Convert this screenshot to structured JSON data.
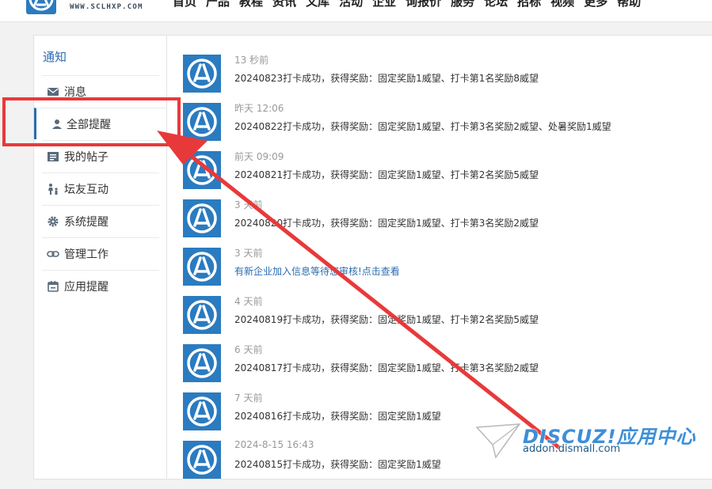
{
  "header": {
    "site_url": "WWW.SCLHXP.COM",
    "nav": [
      "首页",
      "产品",
      "教程",
      "资讯",
      "文库",
      "活动",
      "企业",
      "询报价",
      "服务",
      "论坛",
      "招标",
      "视频",
      "更多",
      "帮助"
    ]
  },
  "sidebar": {
    "title": "通知",
    "items": [
      {
        "label": "消息",
        "icon": "mail-icon"
      },
      {
        "label": "全部提醒",
        "icon": "user-icon",
        "active": true
      },
      {
        "label": "我的帖子",
        "icon": "posts-icon"
      },
      {
        "label": "坛友互动",
        "icon": "interaction-icon"
      },
      {
        "label": "系统提醒",
        "icon": "gear-icon"
      },
      {
        "label": "管理工作",
        "icon": "link-icon"
      },
      {
        "label": "应用提醒",
        "icon": "calendar-icon"
      }
    ]
  },
  "notices": [
    {
      "time": "13 秒前",
      "text": "20240823打卡成功，获得奖励：固定奖励1威望、打卡第1名奖励8威望"
    },
    {
      "time": "昨天 12:06",
      "text": "20240822打卡成功，获得奖励：固定奖励1威望、打卡第3名奖励2威望、处暑奖励1威望"
    },
    {
      "time": "前天 09:09",
      "text": "20240821打卡成功，获得奖励：固定奖励1威望、打卡第2名奖励5威望"
    },
    {
      "time": "3 天前",
      "text": "20240820打卡成功，获得奖励：固定奖励1威望、打卡第3名奖励2威望"
    },
    {
      "time": "3 天前",
      "text": "有新企业加入信息等待您审核!点击查看",
      "link": true
    },
    {
      "time": "4 天前",
      "text": "20240819打卡成功，获得奖励：固定奖励1威望、打卡第2名奖励5威望"
    },
    {
      "time": "6 天前",
      "text": "20240817打卡成功，获得奖励：固定奖励1威望、打卡第3名奖励2威望"
    },
    {
      "time": "7 天前",
      "text": "20240816打卡成功，获得奖励：固定奖励1威望"
    },
    {
      "time": "2024-8-15 16:43",
      "text": "20240815打卡成功，获得奖励：固定奖励1威望"
    }
  ],
  "watermark": {
    "brand": "DISCUZ!应用中心",
    "url": "addon.dismall.com"
  },
  "colors": {
    "accent": "#2b6cb0",
    "avatar_bg": "#2b7bc0",
    "annotation_red": "#e8393a"
  }
}
